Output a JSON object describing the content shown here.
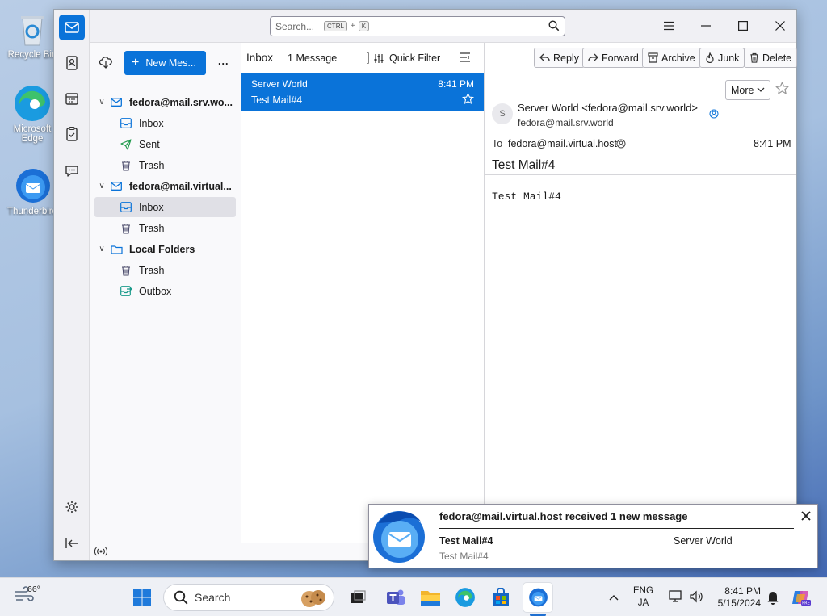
{
  "desktop": {
    "icons": [
      {
        "label": "Recycle Bin"
      },
      {
        "label": "Microsoft Edge"
      },
      {
        "label": "Thunderbird"
      }
    ]
  },
  "titlebar": {
    "search_placeholder": "Search...",
    "kbd_ctrl": "CTRL",
    "kbd_plus": "+",
    "kbd_k": "K"
  },
  "folders": {
    "new_message_label": "New Mes...",
    "more_label": "...",
    "accounts": [
      {
        "name": "fedora@mail.srv.wo...",
        "folders": [
          "Inbox",
          "Sent",
          "Trash"
        ]
      },
      {
        "name": "fedora@mail.virtual...",
        "folders": [
          "Inbox",
          "Trash"
        ]
      },
      {
        "name": "Local Folders",
        "folders": [
          "Trash",
          "Outbox"
        ]
      }
    ]
  },
  "threads": {
    "folder_title": "Inbox",
    "message_count": "1 Message",
    "quick_filter_label": "Quick Filter",
    "messages": [
      {
        "from": "Server World",
        "time": "8:41 PM",
        "subject": "Test Mail#4"
      }
    ]
  },
  "message": {
    "toolbar": {
      "reply": "Reply",
      "forward": "Forward",
      "archive": "Archive",
      "junk": "Junk",
      "delete": "Delete",
      "more": "More"
    },
    "avatar_letter": "S",
    "from_name": "Server World <fedora@mail.srv.world>",
    "from_email": "fedora@mail.srv.world",
    "to_label": "To",
    "to_address": "fedora@mail.virtual.host",
    "time": "8:41 PM",
    "subject": "Test Mail#4",
    "body": "Test Mail#4"
  },
  "notification": {
    "title": "fedora@mail.virtual.host received 1 new message",
    "subject": "Test Mail#4",
    "sender": "Server World",
    "preview": "Test Mail#4"
  },
  "taskbar": {
    "weather_temp": "66°",
    "search_placeholder": "Search",
    "lang_top": "ENG",
    "lang_bottom": "JA",
    "time": "8:41 PM",
    "date": "5/15/2024"
  },
  "colors": {
    "accent": "#0a73d9",
    "selected_folder": "#e0e0e6"
  }
}
